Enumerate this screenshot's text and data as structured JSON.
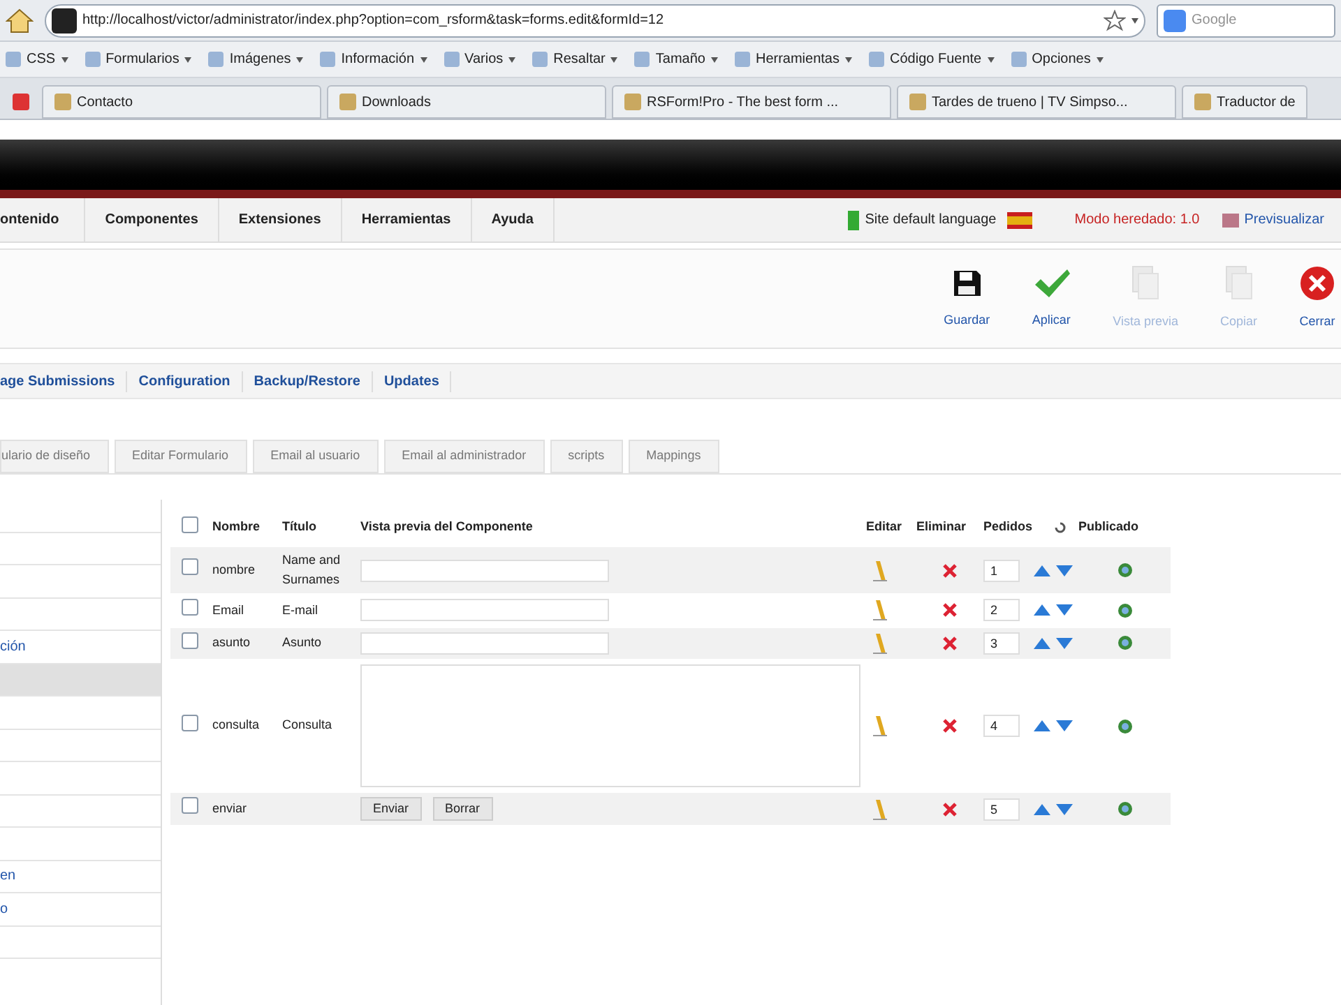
{
  "browser": {
    "url": "http://localhost/victor/administrator/index.php?option=com_rsform&task=forms.edit&formId=12",
    "search_placeholder": "Google",
    "bookmarks": [
      "CSS",
      "Formularios",
      "Imágenes",
      "Información",
      "Varios",
      "Resaltar",
      "Tamaño",
      "Herramientas",
      "Código Fuente",
      "Opciones"
    ],
    "tabs": [
      {
        "label": "Contacto",
        "selected": false
      },
      {
        "label": "Downloads",
        "selected": false
      },
      {
        "label": "RSForm!Pro - The best form ...",
        "selected": false
      },
      {
        "label": "Tardes de trueno | TV Simpso...",
        "selected": false
      },
      {
        "label": "Traductor de",
        "selected": false
      }
    ]
  },
  "menu": {
    "items": [
      "ontenido",
      "Componentes",
      "Extensiones",
      "Herramientas",
      "Ayuda"
    ],
    "language": "Site default language",
    "mode": "Modo heredado: 1.0",
    "preview": "Previsualizar"
  },
  "toolbar": [
    {
      "kind": "save",
      "label": "Guardar",
      "disabled": false
    },
    {
      "kind": "apply",
      "label": "Aplicar",
      "disabled": false
    },
    {
      "kind": "preview",
      "label": "Vista previa",
      "disabled": true
    },
    {
      "kind": "copy",
      "label": "Copiar",
      "disabled": true
    },
    {
      "kind": "close",
      "label": "Cerrar",
      "disabled": false
    }
  ],
  "submenu": [
    "age Submissions",
    "Configuration",
    "Backup/Restore",
    "Updates"
  ],
  "form_tabs": [
    {
      "label": "ulario de diseño",
      "selected": false
    },
    {
      "label": "Editar Formulario",
      "selected": false
    },
    {
      "label": "Email al usuario",
      "selected": false
    },
    {
      "label": "Email al administrador",
      "selected": false
    },
    {
      "label": "scripts",
      "selected": false
    },
    {
      "label": "Mappings",
      "selected": false
    }
  ],
  "sidebar": {
    "items": [
      {
        "selected": false
      },
      {
        "selected": false
      },
      {
        "selected": false
      },
      {
        "selected": false
      },
      {
        "label": "ción",
        "selected": false
      },
      {
        "selected": true
      },
      {
        "selected": false
      },
      {
        "selected": false
      },
      {
        "selected": false
      },
      {
        "selected": false
      },
      {
        "selected": false
      },
      {
        "label": "en",
        "selected": false
      },
      {
        "label": "o",
        "selected": false
      },
      {
        "selected": false
      }
    ]
  },
  "table": {
    "select_all_checked": false,
    "columns": [
      "Nombre",
      "Título",
      "Vista previa del Componente",
      "Editar",
      "Eliminar",
      "Pedidos",
      "Publicado"
    ],
    "rows": [
      {
        "name": "nombre",
        "title": "Name and Surnames",
        "kind": "text",
        "order": "1",
        "checked": false
      },
      {
        "name": "Email",
        "title": "E-mail",
        "kind": "text",
        "order": "2",
        "checked": false
      },
      {
        "name": "asunto",
        "title": "Asunto",
        "kind": "text",
        "order": "3",
        "checked": false
      },
      {
        "name": "consulta",
        "title": "Consulta",
        "kind": "textarea",
        "order": "4",
        "checked": false
      },
      {
        "name": "enviar",
        "kind": "buttons",
        "buttons": [
          "Enviar",
          "Borrar"
        ],
        "order": "5",
        "checked": false
      }
    ]
  }
}
